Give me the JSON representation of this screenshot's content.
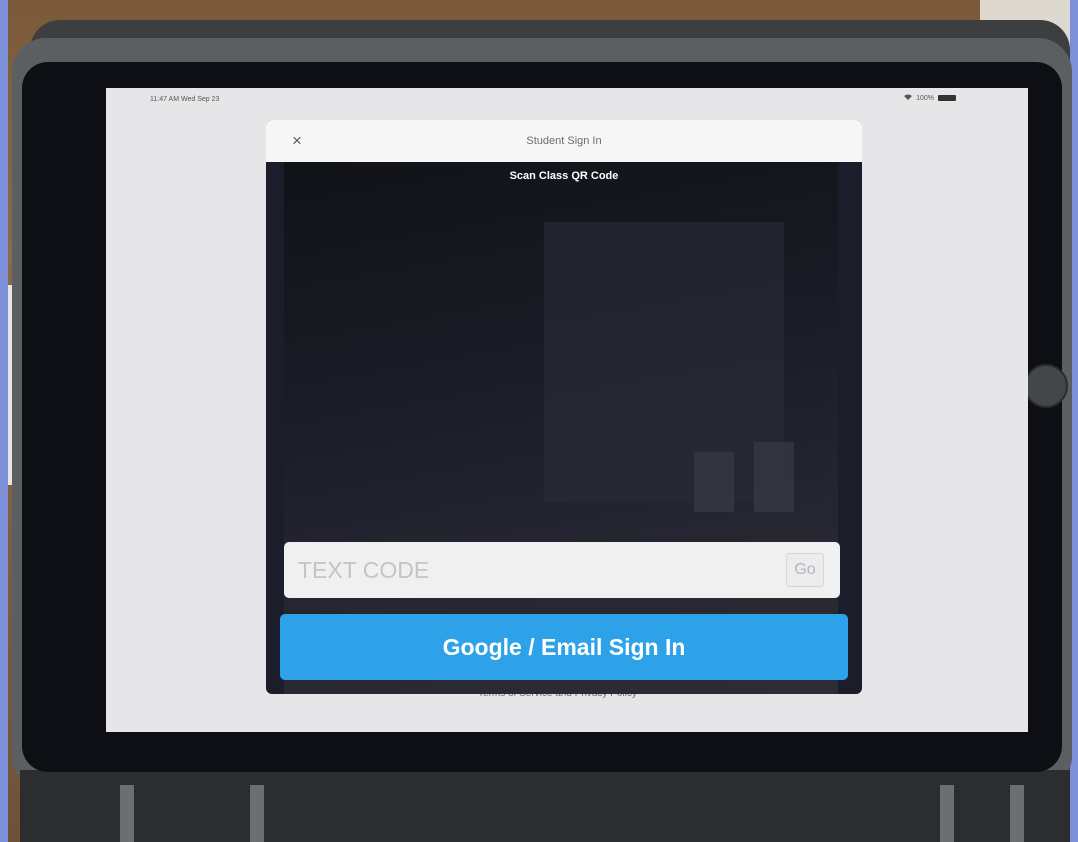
{
  "status_bar": {
    "time": "11:47 AM  Wed Sep 23",
    "battery": "100%"
  },
  "modal": {
    "title": "Student Sign In",
    "close_glyph": "×",
    "scan_label": "Scan Class QR Code",
    "code_input": {
      "placeholder": "TEXT CODE",
      "value": ""
    },
    "go_label": "Go",
    "google_label": "Google / Email Sign In"
  },
  "footer": {
    "terms": "Terms of Service and Privacy Policy"
  },
  "colors": {
    "accent": "#2ea2e8",
    "modal_bg": "#1b1d2b",
    "header_bg": "#f6f6f7"
  },
  "icons": [
    "close-icon",
    "wifi-icon",
    "battery-icon"
  ]
}
